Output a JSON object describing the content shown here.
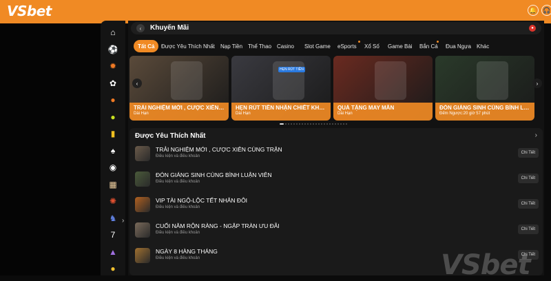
{
  "brand": {
    "logo_text": "VSbet",
    "watermark_text": "VSbet",
    "accent": "#f08a24"
  },
  "topbar": {
    "icons": [
      "bell-icon",
      "headset-icon"
    ],
    "icon_glyphs": [
      "🔔",
      "🎧"
    ]
  },
  "sidebar": {
    "items": [
      {
        "icon": "home-icon",
        "glyph": "⌂",
        "color": "#ffffff"
      },
      {
        "icon": "soccer-icon",
        "glyph": "⚽",
        "color": "#ffffff"
      },
      {
        "icon": "sun-icon",
        "glyph": "✹",
        "color": "#f07a24"
      },
      {
        "icon": "flower-icon",
        "glyph": "✿",
        "color": "#ffffff"
      },
      {
        "icon": "basketball-icon",
        "glyph": "●",
        "color": "#f07a24"
      },
      {
        "icon": "tennis-icon",
        "glyph": "●",
        "color": "#c8e020"
      },
      {
        "icon": "card-icon",
        "glyph": "▮",
        "color": "#f0c020"
      },
      {
        "icon": "spade-icon",
        "glyph": "♠",
        "color": "#ffffff"
      },
      {
        "icon": "chip-icon",
        "glyph": "◉",
        "color": "#ffffff"
      },
      {
        "icon": "cards-icon",
        "glyph": "▦",
        "color": "#f0d0a0"
      },
      {
        "icon": "fish-icon",
        "glyph": "✺",
        "color": "#e05030"
      },
      {
        "icon": "horse-icon",
        "glyph": "♞",
        "color": "#6080e0"
      },
      {
        "icon": "seven-icon",
        "glyph": "7",
        "color": "#ffffff"
      },
      {
        "icon": "cake-icon",
        "glyph": "▲",
        "color": "#a070e0"
      },
      {
        "icon": "coin-icon",
        "glyph": "●",
        "color": "#f0c030"
      }
    ]
  },
  "header": {
    "back_glyph": "‹",
    "title": "Khuyến Mãi",
    "badge_glyph": "●"
  },
  "tabs": [
    "Tất Cả",
    "Được Yêu Thích Nhất",
    "Nạp Tiền",
    "Thể Thao",
    "Casino",
    "Slot Game",
    "eSports",
    "Xổ Số",
    "Game Bài",
    "Bắn Cá",
    "Đua Ngựa",
    "Khác"
  ],
  "banners": [
    {
      "title": "TRẢI NGHIỆM MỚI , CƯỢC XIÊN C...",
      "sub": "Dài Hạn",
      "bg": "#5a4a3a"
    },
    {
      "title": "HẸN RÚT TIỀN NHẬN CHIẾT KHẤU",
      "sub": "Dài Hạn",
      "bg": "#3a3a40"
    },
    {
      "title": "QUÀ TẶNG MAY MẮN",
      "sub": "Dài Hạn",
      "bg": "#6a2a20"
    },
    {
      "title": "ĐÓN GIÁNG SINH CÙNG BÌNH LU...",
      "sub": "Đếm Ngược:20 giờ 57 phút",
      "bg": "#2a3a2a"
    }
  ],
  "banner_mid_label": "HẸN RÚT TIỀN",
  "carousel": {
    "prev_glyph": "‹",
    "next_glyph": "›"
  },
  "favorites": {
    "title": "Được Yêu Thích Nhất",
    "chevron": "›",
    "rows": [
      {
        "title": "TRẢI NGHIỆM MỚI , CƯỢC XIÊN CÙNG TRẬN",
        "sub": "Điều kiện và điều khoản",
        "button": "Chi Tiết",
        "thumb": "#6a5a4a"
      },
      {
        "title": "ĐÓN GIÁNG SINH CÙNG BÌNH LUẬN VIÊN",
        "sub": "Điều kiện và điều khoản",
        "button": "Chi Tiết",
        "thumb": "#4a5a3a"
      },
      {
        "title": "VIP TÀI NGỘ-LỘC TẾT NHÂN ĐÔI",
        "sub": "Điều kiện và điều khoản",
        "button": "Chi Tiết",
        "thumb": "#b06020"
      },
      {
        "title": "CUỐI NĂM RỘN RÀNG - NGẬP TRÀN ƯU ĐÃI",
        "sub": "Điều kiện và điều khoản",
        "button": "Chi Tiết",
        "thumb": "#7a6a5a"
      },
      {
        "title": "NGÀY 8 HÀNG THÁNG",
        "sub": "Điều kiện và điều khoản",
        "button": "Chi Tiết",
        "thumb": "#a07030"
      }
    ]
  }
}
